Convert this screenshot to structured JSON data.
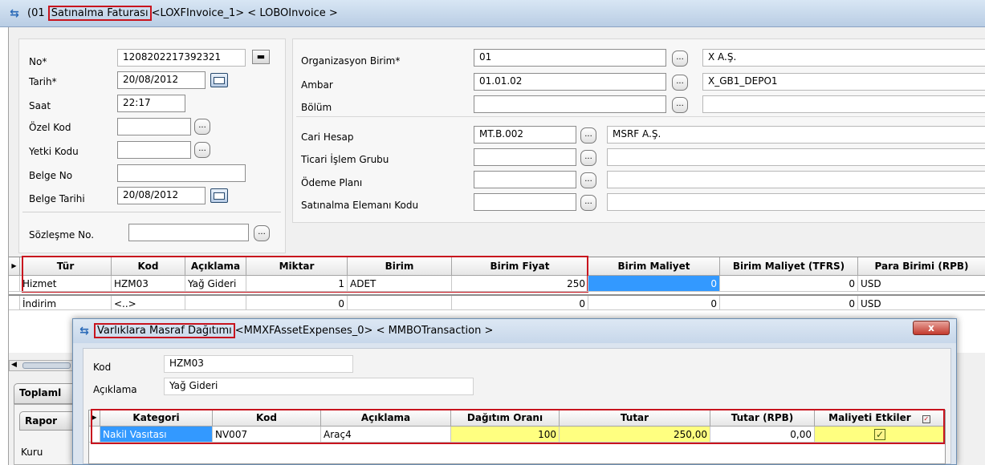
{
  "window": {
    "prefix": "(01",
    "title": "Satınalma Faturası",
    "suffix": "<LOXFInvoice_1> < LOBOInvoice >"
  },
  "form": {
    "no_label": "No*",
    "no_value": "1208202217392321",
    "date_label": "Tarih*",
    "date_value": "20/08/2012",
    "time_label": "Saat",
    "time_value": "22:17",
    "special_code_label": "Özel Kod",
    "auth_code_label": "Yetki Kodu",
    "doc_no_label": "Belge No",
    "doc_date_label": "Belge Tarihi",
    "doc_date_value": "20/08/2012",
    "contract_label": "Sözleşme No.",
    "org_label": "Organizasyon Birim*",
    "org_value": "01",
    "org_desc": "X A.Ş.",
    "warehouse_label": "Ambar",
    "warehouse_value": "01.01.02",
    "warehouse_desc": "X_GB1_DEPO1",
    "dept_label": "Bölüm",
    "account_label": "Cari Hesap",
    "account_value": "MT.B.002",
    "account_desc": "MSRF A.Ş.",
    "trade_group_label": "Ticari İşlem Grubu",
    "payment_label": "Ödeme Planı",
    "buyer_label": "Satınalma Elemanı Kodu"
  },
  "grid": {
    "headers": [
      "Tür",
      "Kod",
      "Açıklama",
      "Miktar",
      "Birim",
      "Birim Fiyat",
      "Birim Maliyet",
      "Birim Maliyet (TFRS)",
      "Para Birimi (RPB)"
    ],
    "row1": [
      "Hizmet",
      "HZM03",
      "Yağ Gideri",
      "1",
      "ADET",
      "250",
      "0",
      "0",
      "USD"
    ],
    "row2": [
      "İndirim",
      "<..>",
      "",
      "0",
      "",
      "0",
      "0",
      "0",
      "USD"
    ]
  },
  "left_tabs": {
    "totals": "Toplaml",
    "reports": "Rapor",
    "currency": "Kuru"
  },
  "dialog": {
    "title": "Varlıklara Masraf Dağıtımı",
    "suffix": "<MMXFAssetExpenses_0> < MMBOTransaction >",
    "close": "x",
    "kod_label": "Kod",
    "kod_value": "HZM03",
    "desc_label": "Açıklama",
    "desc_value": "Yağ Gideri",
    "headers": [
      "Kategori",
      "Kod",
      "Açıklama",
      "Dağıtım Oranı",
      "Tutar",
      "Tutar (RPB)",
      "Maliyeti Etkiler"
    ],
    "row": [
      "Nakil Vasıtası",
      "NV007",
      "Araç4",
      "100",
      "250,00",
      "0,00"
    ],
    "checked": true
  },
  "colors": {
    "highlight_red": "#c8141e",
    "selected_blue": "#3399ff",
    "yellow": "#ffff80"
  }
}
